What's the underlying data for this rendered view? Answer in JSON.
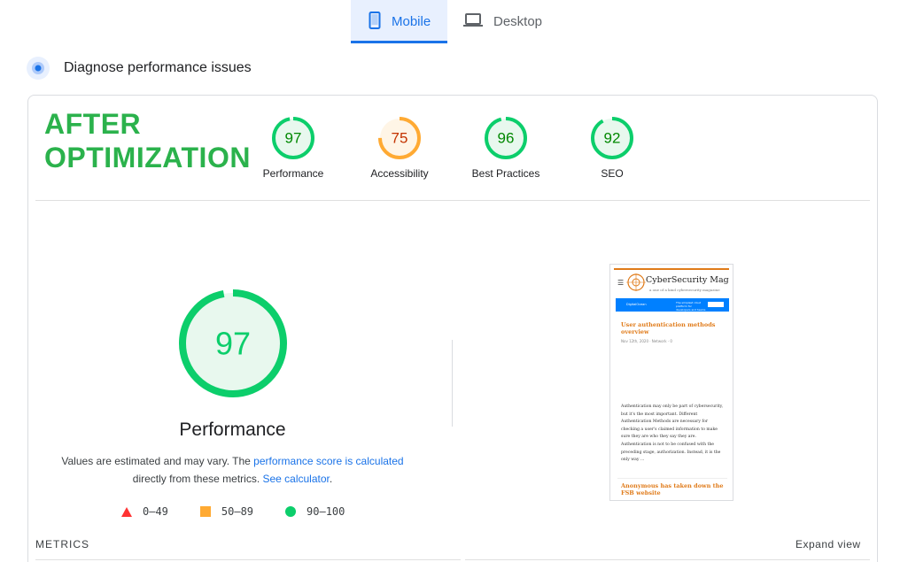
{
  "tabs": [
    {
      "label": "Mobile",
      "icon": "smartphone-icon",
      "active": true
    },
    {
      "label": "Desktop",
      "icon": "laptop-icon",
      "active": false
    }
  ],
  "section": {
    "title": "Diagnose performance issues",
    "icon": "diagnose-icon"
  },
  "overlay_label": {
    "line1": "AFTER",
    "line2": "OPTIMIZATION",
    "color": "#2bb24c"
  },
  "categories": [
    {
      "label": "Performance",
      "score": "97",
      "level": 0.97,
      "status": "pass"
    },
    {
      "label": "Accessibility",
      "score": "75",
      "level": 0.75,
      "status": "average"
    },
    {
      "label": "Best Practices",
      "score": "96",
      "level": 0.96,
      "status": "pass"
    },
    {
      "label": "SEO",
      "score": "92",
      "level": 0.92,
      "status": "pass"
    }
  ],
  "main": {
    "score": "97",
    "level": 0.97,
    "title": "Performance",
    "desc_part1": "Values are estimated and may vary. The ",
    "desc_link1": "performance score is calculated",
    "desc_part2": "directly from these metrics. ",
    "desc_link2": "See calculator",
    "desc_part3": "."
  },
  "legend": [
    {
      "label": "0–49",
      "shape": "triangle",
      "color": "#ff3333"
    },
    {
      "label": "50–89",
      "shape": "square",
      "color": "#ffaa33"
    },
    {
      "label": "90–100",
      "shape": "circle",
      "color": "#0cce6b"
    }
  ],
  "metrics_label": "METRICS",
  "expand_label": "Expand view",
  "colors": {
    "pass": "#0cce6b",
    "pass_bg": "#e8f8ee",
    "pass_text": "#008800",
    "average": "#ffaa33",
    "average_bg": "#fff5e6",
    "average_text": "#c33300",
    "accent": "#1a73e8"
  },
  "screenshot": {
    "site_name": "CyberSecurity Mag",
    "tagline": "a one of a kind cybersecurity magazine",
    "banner_brand": "DigitalOcean",
    "banner_text": "The simplest cloud platform for developers and teams",
    "article1_title": "User authentication methods overview",
    "article1_meta": "Nov 12th, 2020 · Network · 0",
    "article1_body": "Authentication may only be part of cybersecurity, but it's the most important. Different Authentication Methods are necessary for checking a user's claimed information to make sure they are who they say they are. Authentication is not to be confused with the preceding stage, authorization. Instead, it is the only way ...",
    "article2_title": "Anonymous has taken down the FSB website"
  }
}
